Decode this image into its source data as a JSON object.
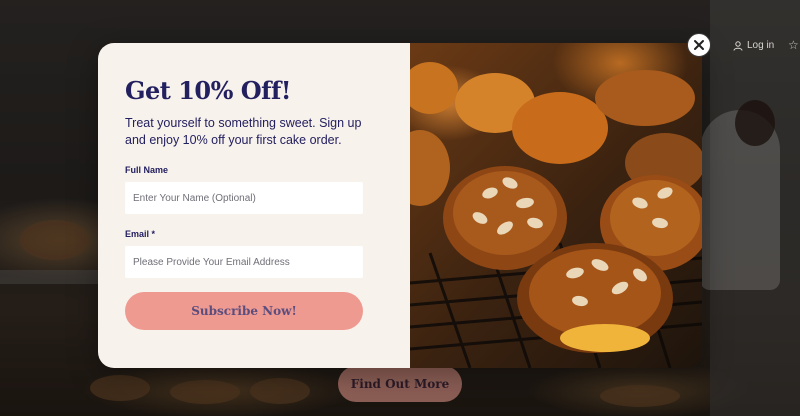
{
  "background": {
    "login_label": "Log in",
    "find_more_label": "Find Out More"
  },
  "modal": {
    "title": "Get 10% Off!",
    "description": "Treat yourself to something sweet. Sign up and enjoy 10% off your first cake order.",
    "full_name": {
      "label": "Full Name",
      "placeholder": "Enter Your Name (Optional)",
      "value": ""
    },
    "email": {
      "label": "Email *",
      "placeholder": "Please Provide Your Email Address",
      "value": ""
    },
    "subscribe_label": "Subscribe Now!",
    "close_icon": "close-icon",
    "image_subject": "croissant-photo"
  },
  "colors": {
    "modal_bg": "#f8f2ec",
    "title_color": "#232060",
    "subscribe_button": "#ef9a90",
    "subscribe_text": "#5b4d7e"
  }
}
